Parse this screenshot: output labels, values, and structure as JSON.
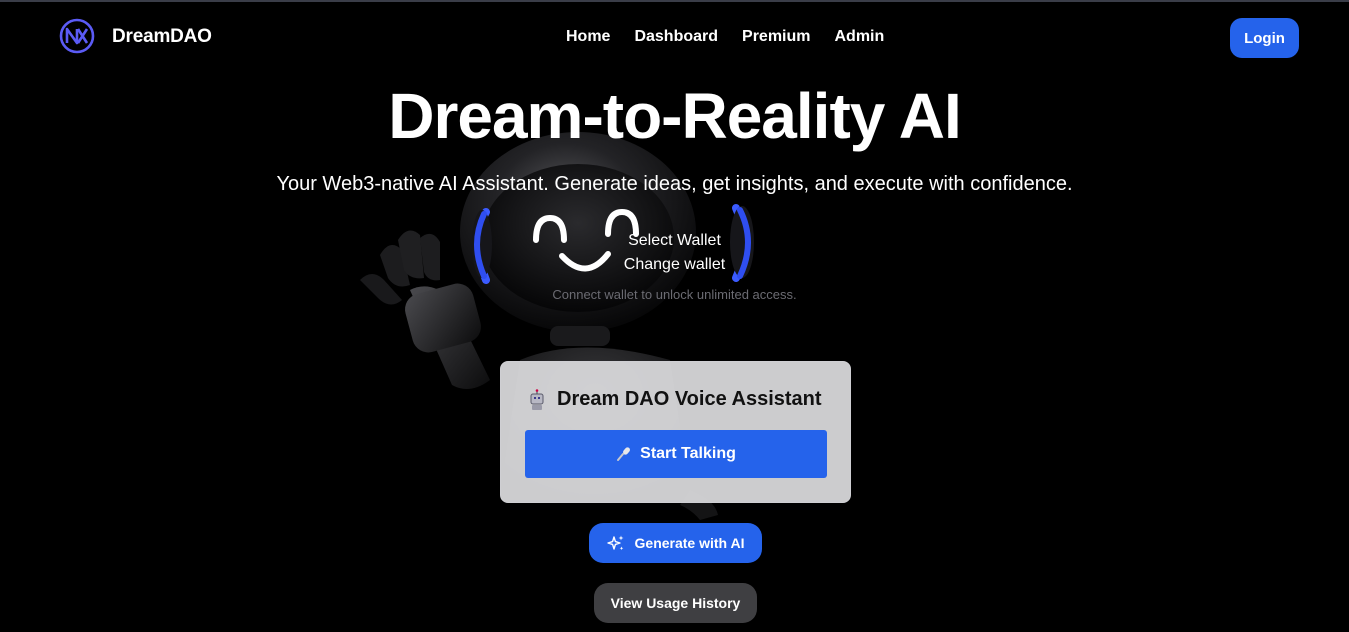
{
  "brand": {
    "name": "DreamDAO",
    "logo_icon": "nx-logo-icon"
  },
  "nav": {
    "links": [
      "Home",
      "Dashboard",
      "Premium",
      "Admin"
    ],
    "login_label": "Login"
  },
  "hero": {
    "title": "Dream-to-Reality AI",
    "subtitle": "Your Web3-native AI Assistant. Generate ideas, get insights, and execute with confidence."
  },
  "wallet": {
    "select_label": "Select Wallet",
    "change_label": "Change wallet",
    "hint": "Connect wallet to unlock unlimited access."
  },
  "voice_assistant": {
    "title": "Dream DAO Voice Assistant",
    "title_icon": "robot-icon",
    "start_label": "Start Talking",
    "start_icon": "microphone-icon"
  },
  "actions": {
    "generate_label": "Generate with AI",
    "generate_icon": "sparkles-icon",
    "history_label": "View Usage History"
  },
  "colors": {
    "accent": "#2563eb",
    "background": "#000000",
    "secondary_button": "#3f3f42"
  }
}
